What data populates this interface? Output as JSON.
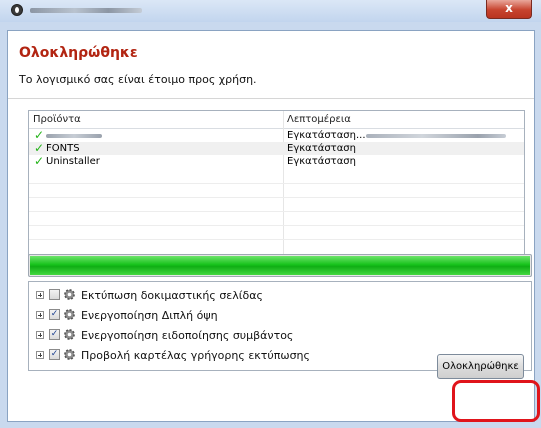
{
  "window": {
    "close_glyph": "x"
  },
  "dialog": {
    "heading": "Ολοκληρώθηκε",
    "subtext": "Το λογισμικό σας είναι έτοιμο προς χρήση.",
    "accent_color": "#b22512"
  },
  "table": {
    "columns": [
      "Προϊόντα",
      "Λεπτομέρεια"
    ],
    "rows": [
      {
        "product": "",
        "detail": "Εγκατάσταση...",
        "status": "success"
      },
      {
        "product": "FONTS",
        "detail": "Εγκατάσταση",
        "status": "success"
      },
      {
        "product": "Uninstaller",
        "detail": "Εγκατάσταση",
        "status": "success"
      }
    ]
  },
  "progress": {
    "value_percent": 100,
    "color": "#17c31c"
  },
  "options": [
    {
      "label": "Εκτύπωση δοκιμαστικής σελίδας",
      "checked": false
    },
    {
      "label": "Ενεργοποίηση Διπλή όψη",
      "checked": true
    },
    {
      "label": "Ενεργοποίηση ειδοποίησης συμβάντος",
      "checked": true
    },
    {
      "label": "Προβολή καρτέλας γρήγορης εκτύπωσης",
      "checked": true
    }
  ],
  "footer": {
    "done_label": "Ολοκληρώθηκε",
    "highlight_color": "#e0141b"
  },
  "icons": {
    "success": "check-icon",
    "option": "gear-icon",
    "expand": "plus-expander-icon"
  }
}
